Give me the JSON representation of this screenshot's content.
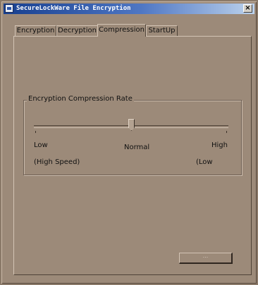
{
  "window": {
    "title": "SecureLockWare File Encryption",
    "close_glyph": "×"
  },
  "tabs": [
    {
      "label": "Encryption",
      "active": false
    },
    {
      "label": "Decryption",
      "active": false
    },
    {
      "label": "Compression",
      "active": true
    },
    {
      "label": "StartUp",
      "active": false
    }
  ],
  "compression": {
    "group_title": "Encryption Compression Rate",
    "slider_level": 0.5,
    "label_low": "Low",
    "label_normal": "Normal",
    "label_high": "High",
    "label_low_note": "(High Speed)",
    "label_high_note": "(Low"
  },
  "ok_button": {
    "label": "..."
  },
  "colors": {
    "background": "#9c8a79",
    "titlebar": "#173f8f"
  }
}
